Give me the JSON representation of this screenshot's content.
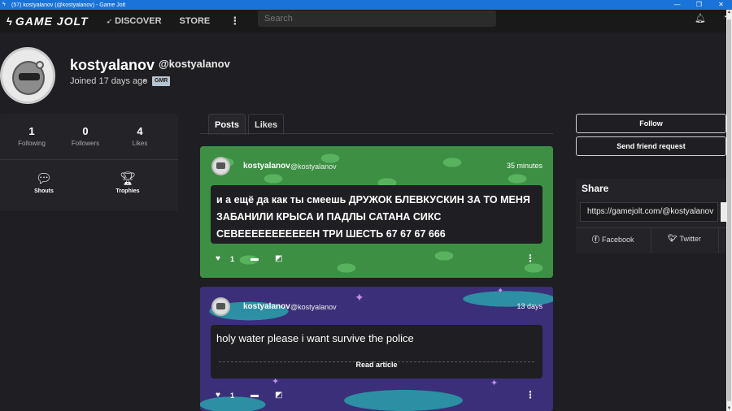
{
  "window": {
    "title": "(57) kostyalanov (@kostyalanov) - Game Jolt",
    "minimize": "—",
    "maximize": "❐",
    "close": "✕"
  },
  "nav": {
    "logo": "GAME JOLT",
    "discover": "DISCOVER",
    "store": "STORE",
    "more": "⋮",
    "search_placeholder": "Search"
  },
  "profile": {
    "display_name": "kostyalanov",
    "handle": "@kostyalanov",
    "joined": "Joined 17 days ago",
    "separator": "•",
    "badge": "GMR"
  },
  "stats": [
    {
      "value": "1",
      "label": "Following"
    },
    {
      "value": "0",
      "label": "Followers"
    },
    {
      "value": "4",
      "label": "Likes"
    }
  ],
  "shortcuts": [
    {
      "label": "Shouts",
      "icon": "speech-bubble-icon"
    },
    {
      "label": "Trophies",
      "icon": "trophy-icon"
    }
  ],
  "tabs": [
    {
      "label": "Posts",
      "active": true
    },
    {
      "label": "Likes",
      "active": false
    }
  ],
  "posts": [
    {
      "user": "kostyalanov",
      "handle": "@kostyalanov",
      "time": "35 minutes",
      "body": "и а ещё да как ты смеешь ДРУЖОК БЛЕВКУСКИН ЗА ТО МЕНЯ ЗАБАНИЛИ КРЫСА И ПАДЛЫ САТАНА СИКС СЕВЕЕЕЕЕЕЕЕЕЕЕН ТРИ ШЕСТЬ 67 67 67 666",
      "likes": "1"
    },
    {
      "user": "kostyalanov",
      "handle": "@kostyalanov",
      "time": "13 days",
      "body": "holy water please i want survive the police",
      "read_more": "Read article",
      "likes": "1"
    }
  ],
  "actions": {
    "follow": "Follow",
    "friend_request": "Send friend request"
  },
  "share": {
    "title": "Share",
    "url": "https://gamejolt.com/@kostyalanov",
    "facebook": "Facebook",
    "twitter": "Twitter"
  },
  "colors": {
    "background": "#1f1f23",
    "titlebar": "#1a73d9",
    "post1_bg": "#3c8f43",
    "post2_bg": "#3a2f78"
  }
}
